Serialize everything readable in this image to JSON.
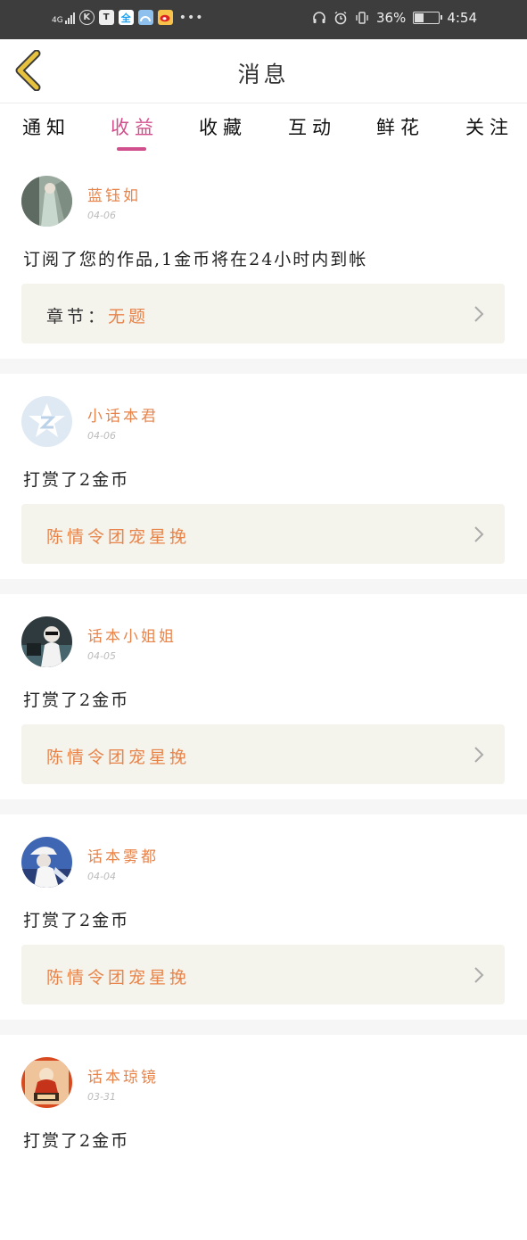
{
  "status_bar": {
    "network": "4G",
    "battery": "36%",
    "time": "4:54"
  },
  "header": {
    "title": "消息"
  },
  "tabs": [
    {
      "label": "通知"
    },
    {
      "label": "收益"
    },
    {
      "label": "收藏"
    },
    {
      "label": "互动"
    },
    {
      "label": "鲜花"
    },
    {
      "label": "关注"
    }
  ],
  "active_tab": "收益",
  "messages": [
    {
      "user": "蓝钰如",
      "date": "04-06",
      "text": "订阅了您的作品,1金币将在24小时内到帐",
      "card_prefix": "章节：",
      "card_value": "无题"
    },
    {
      "user": "小话本君",
      "date": "04-06",
      "text": "打赏了2金币",
      "card_prefix": "",
      "card_value": "陈情令团宠星挽"
    },
    {
      "user": "话本小姐姐",
      "date": "04-05",
      "text": "打赏了2金币",
      "card_prefix": "",
      "card_value": "陈情令团宠星挽"
    },
    {
      "user": "话本雾都",
      "date": "04-04",
      "text": "打赏了2金币",
      "card_prefix": "",
      "card_value": "陈情令团宠星挽"
    },
    {
      "user": "话本琼镜",
      "date": "03-31",
      "text": "打赏了2金币",
      "card_prefix": "",
      "card_value": ""
    }
  ],
  "colors": {
    "accent": "#d24f8d",
    "username": "#e8844a",
    "card_bg": "#f4f3ec",
    "back_arrow": "#e7c23e"
  }
}
